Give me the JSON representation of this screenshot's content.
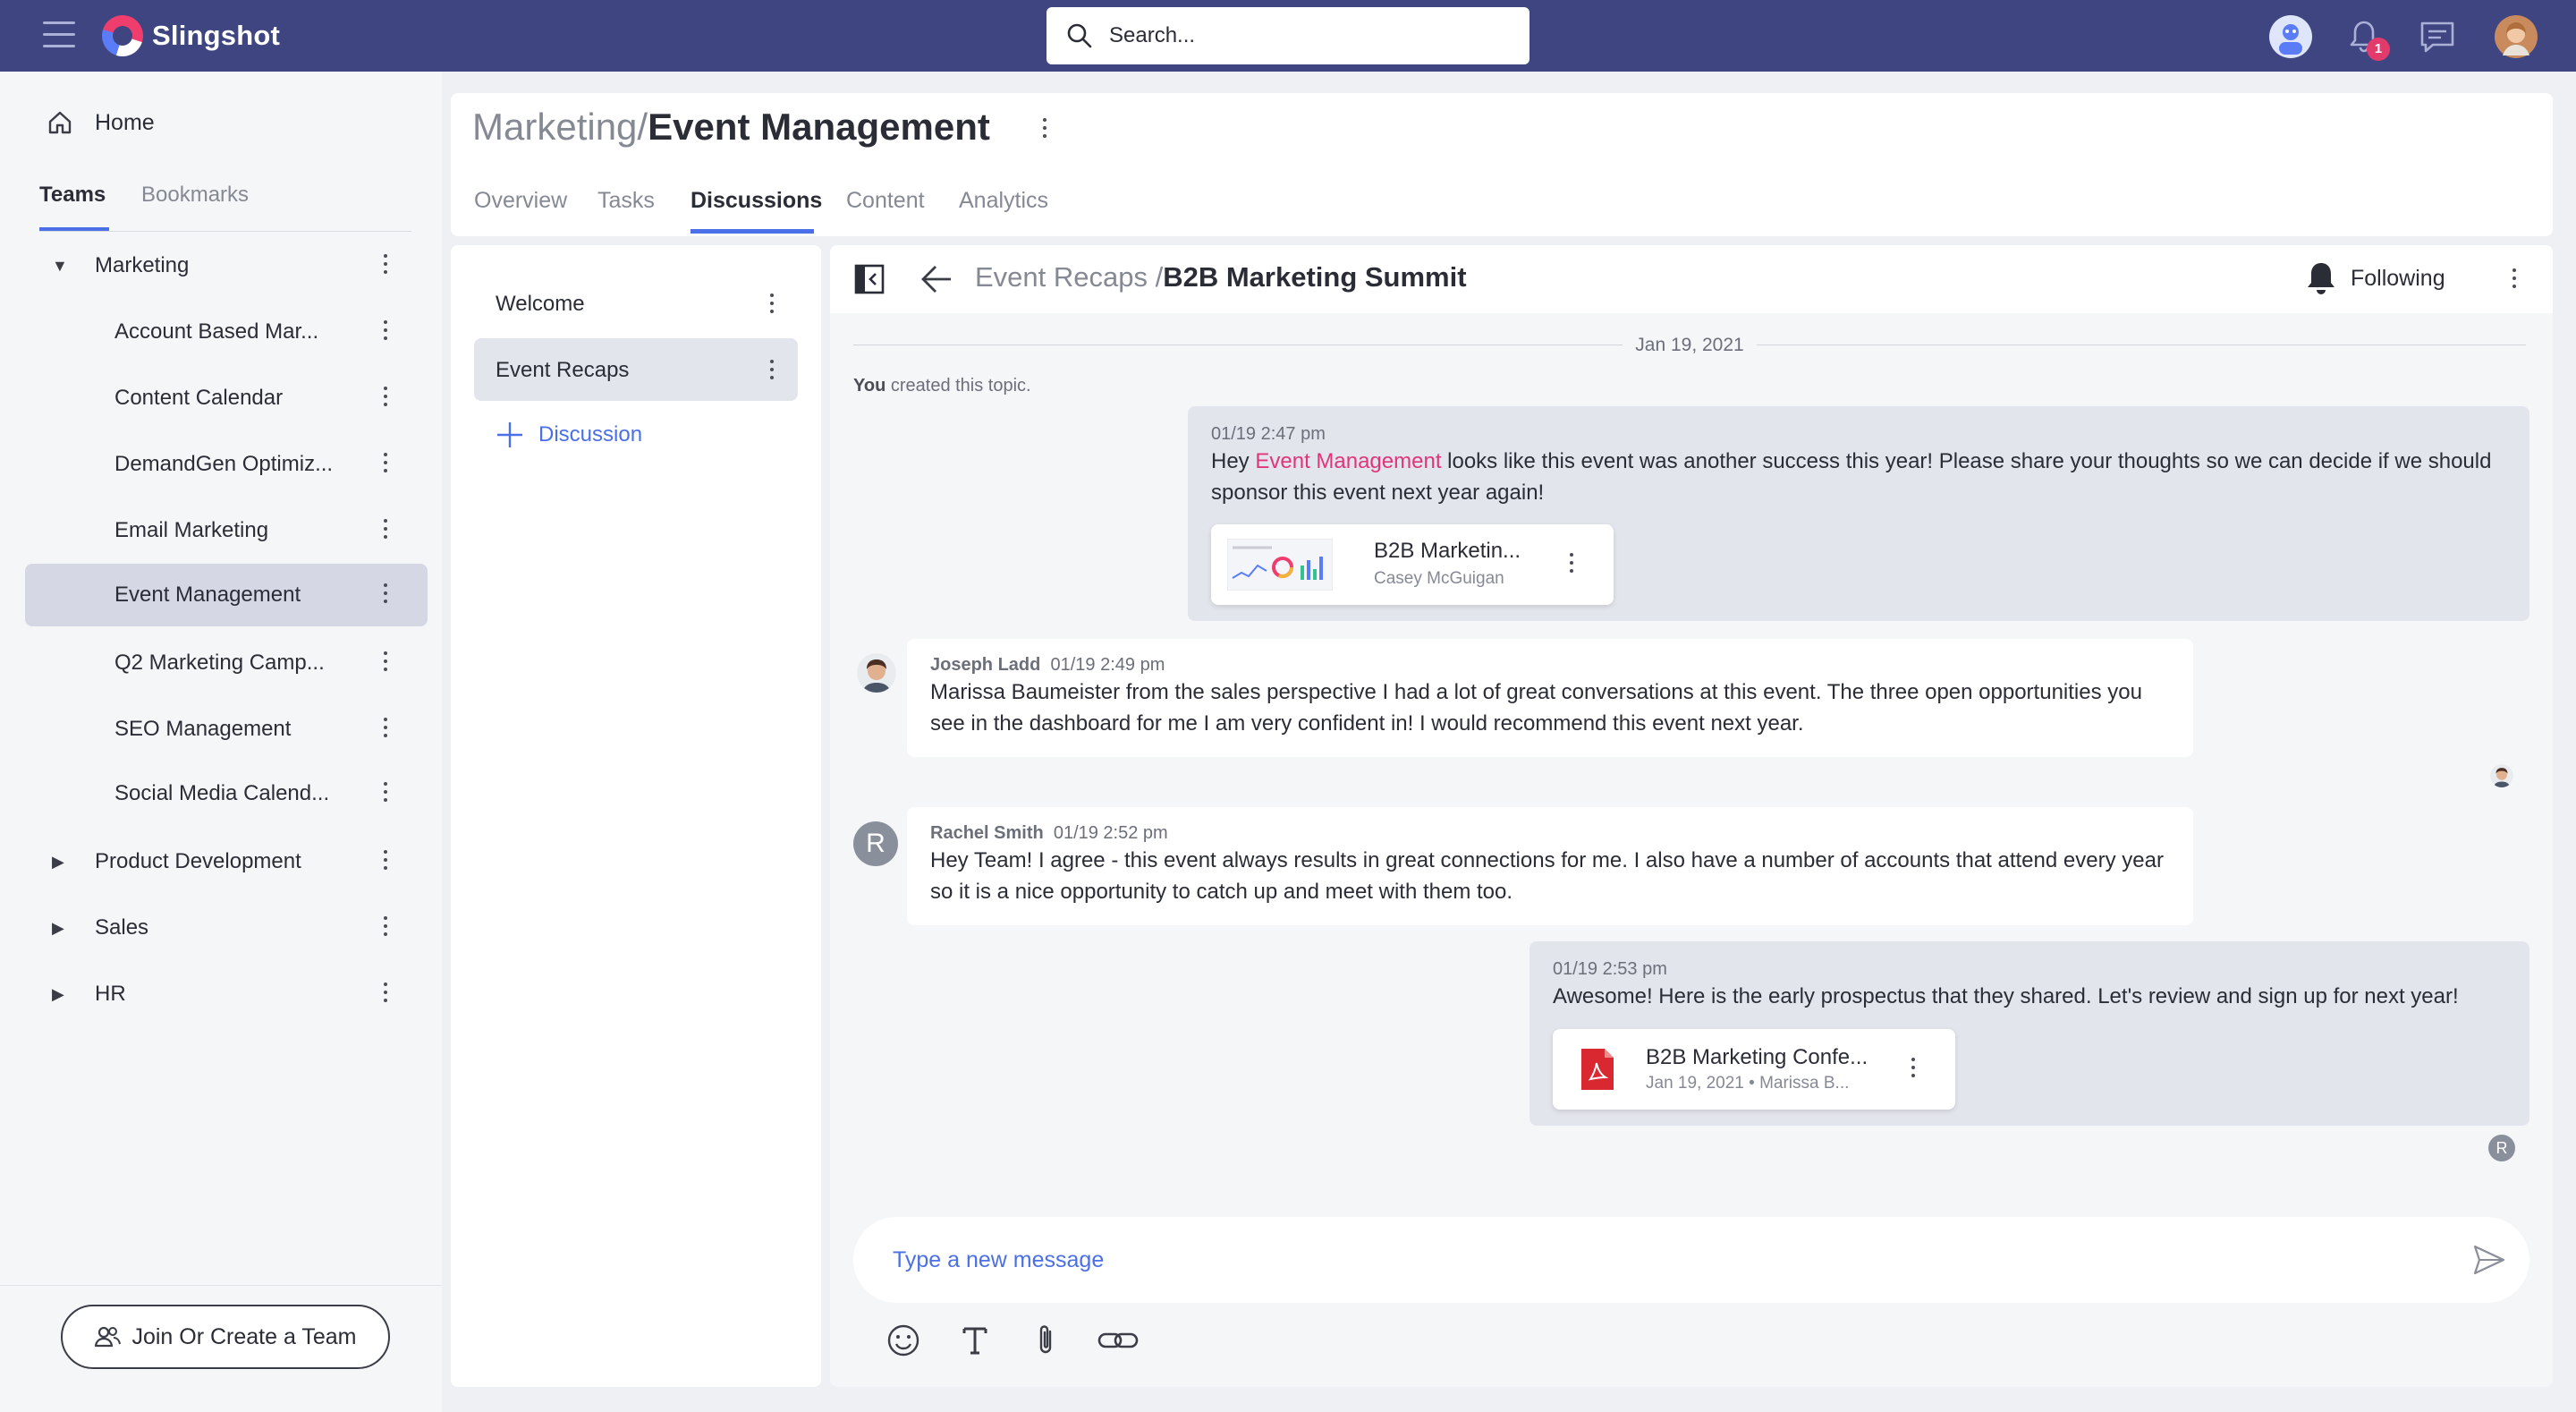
{
  "app": {
    "name": "Slingshot"
  },
  "search": {
    "placeholder": "Search..."
  },
  "notifications": {
    "count": "1"
  },
  "sidebar": {
    "home_label": "Home",
    "tabs": [
      {
        "label": "Teams"
      },
      {
        "label": "Bookmarks"
      }
    ],
    "teams": [
      {
        "label": "Marketing",
        "expanded": true
      },
      {
        "label": "Account Based Mar..."
      },
      {
        "label": "Content Calendar"
      },
      {
        "label": "DemandGen Optimiz..."
      },
      {
        "label": "Email Marketing"
      },
      {
        "label": "Event Management",
        "selected": true
      },
      {
        "label": "Q2 Marketing Camp..."
      },
      {
        "label": "SEO Management"
      },
      {
        "label": "Social Media Calend..."
      },
      {
        "label": "Product Development"
      },
      {
        "label": "Sales"
      },
      {
        "label": "HR"
      }
    ],
    "join_button": "Join Or Create a Team"
  },
  "header": {
    "parent": "Marketing",
    "separator": "/",
    "title": "Event Management",
    "tabs": [
      {
        "label": "Overview"
      },
      {
        "label": "Tasks"
      },
      {
        "label": "Discussions",
        "active": true
      },
      {
        "label": "Content"
      },
      {
        "label": "Analytics"
      }
    ]
  },
  "topics": {
    "items": [
      {
        "label": "Welcome"
      },
      {
        "label": "Event Recaps",
        "selected": true
      }
    ],
    "add_label": "Discussion"
  },
  "conversation": {
    "parent": "Event Recaps /",
    "title": "B2B Marketing Summit",
    "following_label": "Following",
    "date_separator": "Jan 19, 2021",
    "system_note": {
      "actor": "You",
      "text": " created this topic."
    },
    "messages": [
      {
        "timestamp": "01/19 2:47 pm",
        "text_before": "Hey ",
        "mention": "Event Management",
        "text_after": " looks like this event was another success this year! Please share your thoughts so we can decide if we should sponsor this event next year again!",
        "attachment": {
          "name": "B2B Marketin...",
          "sub": "Casey McGuigan",
          "thumb_colors": [
            "#5b7cf7",
            "#ef3e6d",
            "#f2b23c",
            "#34c38f"
          ]
        }
      },
      {
        "author": "Joseph Ladd",
        "timestamp": "01/19 2:49 pm",
        "text": "Marissa Baumeister from the sales perspective I had a lot of great conversations at this event.  The three open opportunities you see in the dashboard for me I am very confident in! I would recommend this event next year."
      },
      {
        "author": "Rachel Smith",
        "avatar_letter": "R",
        "timestamp": "01/19 2:52 pm",
        "text": "Hey Team! I agree - this event always results in great connections for me. I also have a number of accounts that attend every year so it is a nice opportunity to catch up and meet with them too."
      },
      {
        "timestamp": "01/19 2:53 pm",
        "text": "Awesome! Here is the early prospectus that they shared. Let's review and sign up for next year!",
        "attachment": {
          "name": "B2B Marketing Confe...",
          "sub": "Jan 19, 2021 • Marissa B...",
          "icon": "pdf-icon",
          "icon_color": "#d9282f"
        }
      }
    ],
    "read_receipt_letter": "R",
    "composer_placeholder": "Type a new message"
  },
  "colors": {
    "topbar": "#3e4580",
    "accent": "#4b6fe6",
    "mention": "#e0357a",
    "badge": "#e33a6c"
  }
}
